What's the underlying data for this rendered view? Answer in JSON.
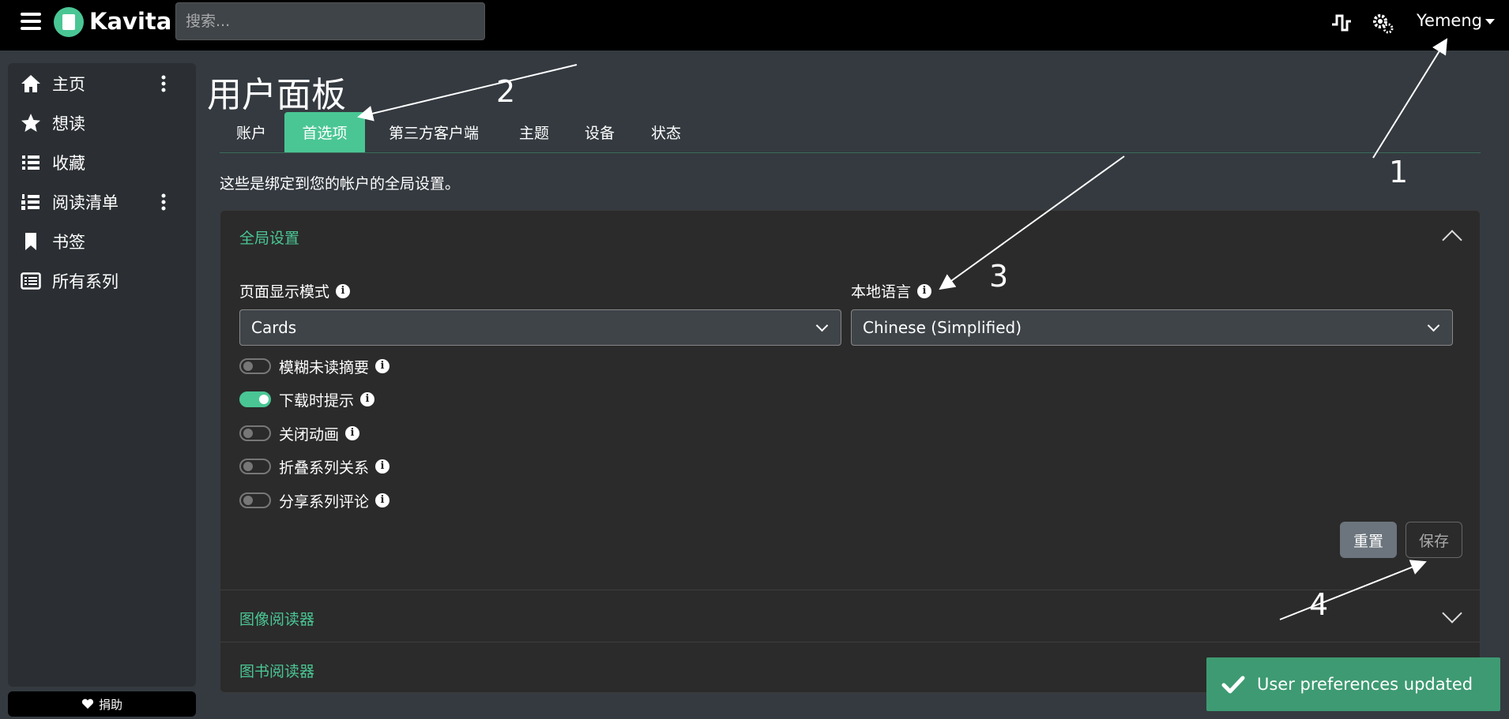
{
  "header": {
    "brand": "Kavita",
    "search_placeholder": "搜索...",
    "user": "Yemeng",
    "icons": [
      "menu-icon",
      "activity-icon",
      "settings-icon"
    ]
  },
  "sidebar": {
    "items": [
      {
        "label": "主页",
        "icon": "home-icon",
        "has_menu": true
      },
      {
        "label": "想读",
        "icon": "star-icon",
        "has_menu": false
      },
      {
        "label": "收藏",
        "icon": "list-icon",
        "has_menu": false
      },
      {
        "label": "阅读清单",
        "icon": "ordered-list-icon",
        "has_menu": true
      },
      {
        "label": "书签",
        "icon": "bookmark-icon",
        "has_menu": false
      },
      {
        "label": "所有系列",
        "icon": "list-alt-icon",
        "has_menu": false
      }
    ],
    "donate_label": "捐助"
  },
  "main": {
    "title": "用户面板",
    "tabs": [
      {
        "label": "账户",
        "active": false
      },
      {
        "label": "首选项",
        "active": true
      },
      {
        "label": "第三方客户端",
        "active": false
      },
      {
        "label": "主题",
        "active": false
      },
      {
        "label": "设备",
        "active": false
      },
      {
        "label": "状态",
        "active": false
      }
    ],
    "description": "这些是绑定到您的帐户的全局设置。",
    "global": {
      "title": "全局设置",
      "page_layout_label": "页面显示模式",
      "page_layout_value": "Cards",
      "locale_label": "本地语言",
      "locale_value": "Chinese (Simplified)",
      "toggles": [
        {
          "label": "模糊未读摘要",
          "on": false
        },
        {
          "label": "下载时提示",
          "on": true
        },
        {
          "label": "关闭动画",
          "on": false
        },
        {
          "label": "折叠系列关系",
          "on": false
        },
        {
          "label": "分享系列评论",
          "on": false
        }
      ],
      "reset_label": "重置",
      "save_label": "保存"
    },
    "image_reader_title": "图像阅读器",
    "book_reader_title": "图书阅读器"
  },
  "toast": {
    "message": "User preferences updated"
  },
  "annotations": [
    "1",
    "2",
    "3",
    "4"
  ],
  "colors": {
    "accent": "#4ac694",
    "background": "#343a40",
    "panel": "#2b2b2b",
    "toast": "#3e9a72"
  }
}
